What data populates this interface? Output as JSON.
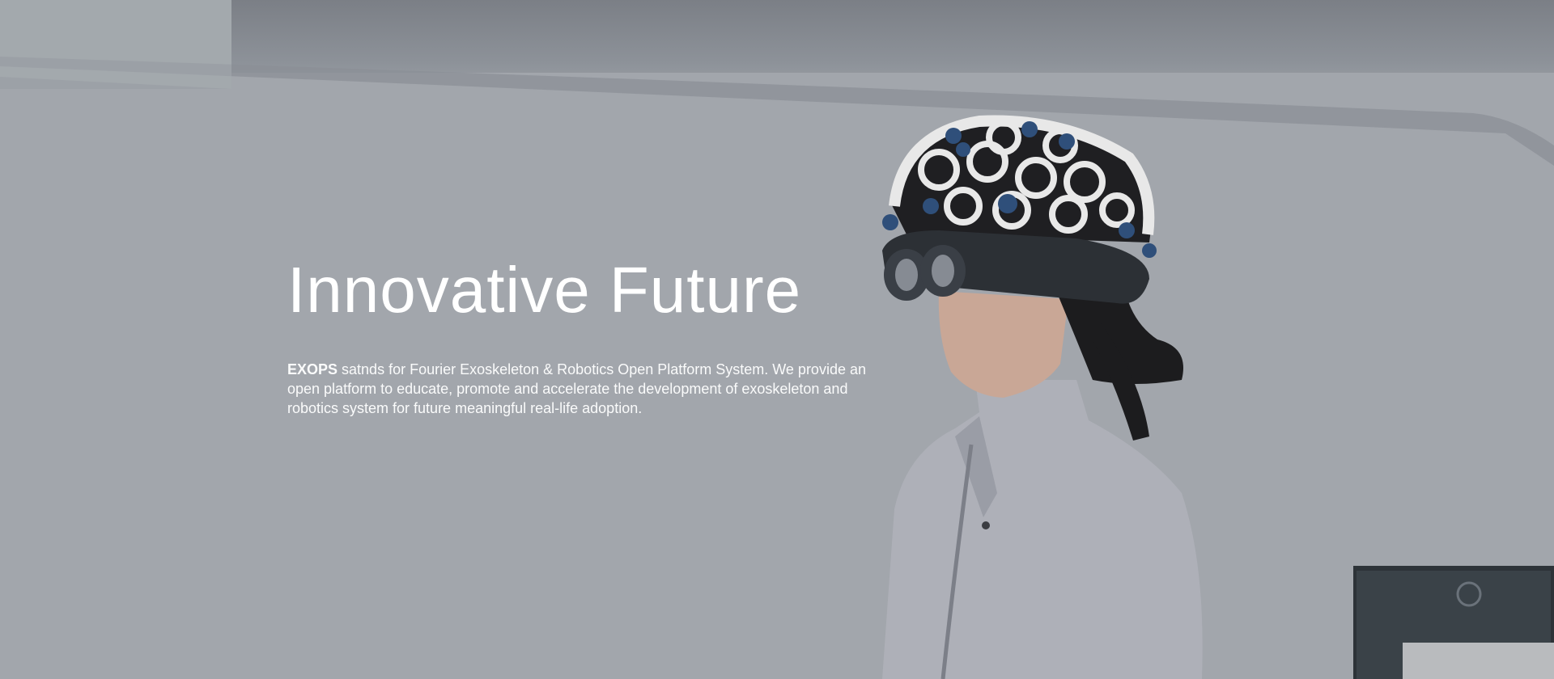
{
  "hero": {
    "title": "Innovative Future",
    "brand": "EXOPS",
    "description": " satnds for Fourier Exoskeleton & Robotics Open Platform System. We provide an open platform to educate, promote and accelerate the development of exoskeleton and robotics system for future meaningful real-life adoption."
  },
  "imagery": {
    "subject": "person-wearing-eeg-cap-and-ar-headset",
    "colors": {
      "background": "#a2a6ac",
      "ceiling": "#7b7f86",
      "jacket": "#aeb0b8",
      "eeg_cap": "#e8e8e8",
      "electrodes": "#2f4f7a",
      "headset": "#2c3035",
      "hair": "#1c1c1e",
      "skin": "#c9a796"
    }
  }
}
